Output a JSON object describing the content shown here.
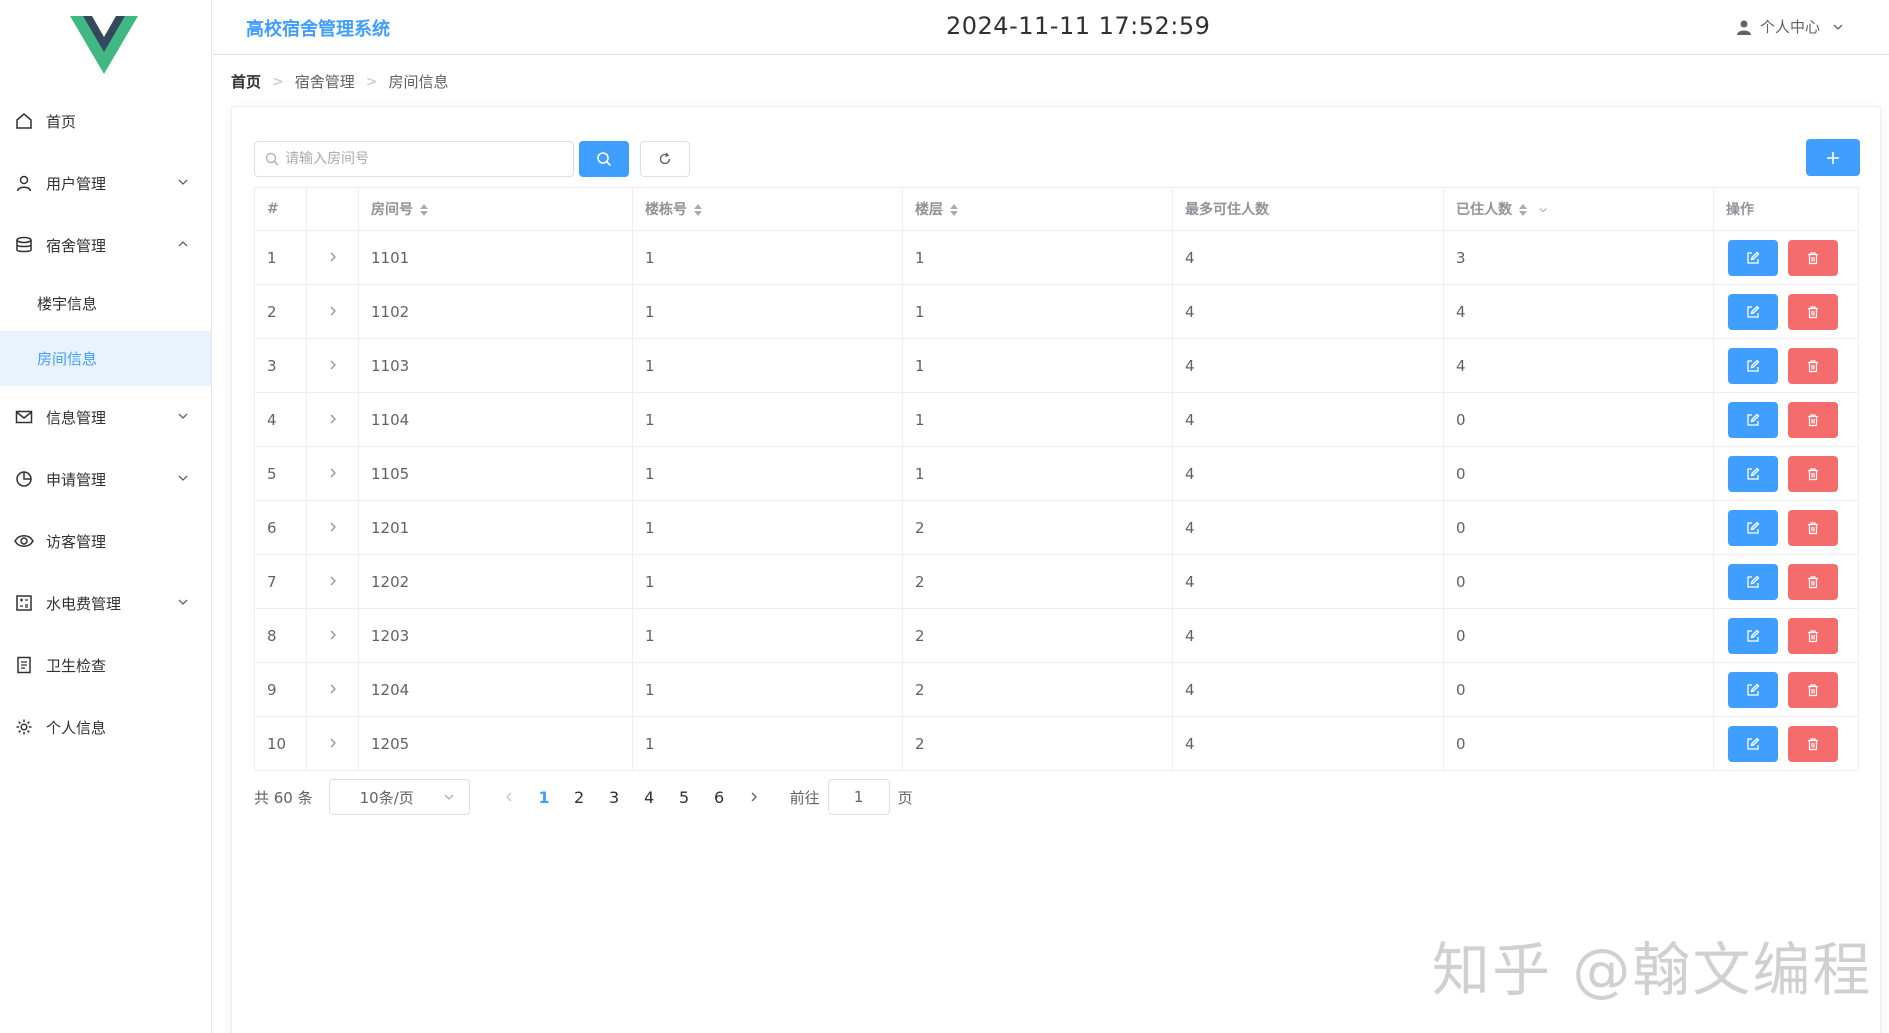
{
  "header": {
    "title": "高校宿舍管理系统",
    "datetime": "2024-11-11 17:52:59",
    "user_menu": "个人中心"
  },
  "sidebar": {
    "items": [
      {
        "label": "首页",
        "icon": "home-icon"
      },
      {
        "label": "用户管理",
        "icon": "user-icon"
      },
      {
        "label": "宿舍管理",
        "icon": "database-icon"
      },
      {
        "label": "楼宇信息"
      },
      {
        "label": "房间信息"
      },
      {
        "label": "信息管理",
        "icon": "mail-icon"
      },
      {
        "label": "申请管理",
        "icon": "pie-chart-icon"
      },
      {
        "label": "访客管理",
        "icon": "eye-icon"
      },
      {
        "label": "水电费管理",
        "icon": "calculator-icon"
      },
      {
        "label": "卫生检查",
        "icon": "document-icon"
      },
      {
        "label": "个人信息",
        "icon": "gear-icon"
      }
    ]
  },
  "breadcrumb": [
    "首页",
    "宿舍管理",
    "房间信息"
  ],
  "search": {
    "placeholder": "请输入房间号",
    "value": ""
  },
  "table": {
    "headers": [
      "#",
      "",
      "房间号",
      "楼栋号",
      "楼层",
      "最多可住人数",
      "已住人数",
      "操作"
    ],
    "rows": [
      [
        "1",
        "1101",
        "1",
        "1",
        "4",
        "3"
      ],
      [
        "2",
        "1102",
        "1",
        "1",
        "4",
        "4"
      ],
      [
        "3",
        "1103",
        "1",
        "1",
        "4",
        "4"
      ],
      [
        "4",
        "1104",
        "1",
        "1",
        "4",
        "0"
      ],
      [
        "5",
        "1105",
        "1",
        "1",
        "4",
        "0"
      ],
      [
        "6",
        "1201",
        "1",
        "2",
        "4",
        "0"
      ],
      [
        "7",
        "1202",
        "1",
        "2",
        "4",
        "0"
      ],
      [
        "8",
        "1203",
        "1",
        "2",
        "4",
        "0"
      ],
      [
        "9",
        "1204",
        "1",
        "2",
        "4",
        "0"
      ],
      [
        "10",
        "1205",
        "1",
        "2",
        "4",
        "0"
      ]
    ]
  },
  "pagination": {
    "total": "共 60 条",
    "page_size": "10条/页",
    "pages": [
      "1",
      "2",
      "3",
      "4",
      "5",
      "6"
    ],
    "current": "1",
    "goto_prefix": "前往",
    "goto_value": "1",
    "goto_suffix": "页"
  },
  "watermark": "知乎 @翰文编程",
  "colors": {
    "primary": "#409eff",
    "danger": "#f56c6c",
    "active_bg": "#e8f3ff"
  }
}
